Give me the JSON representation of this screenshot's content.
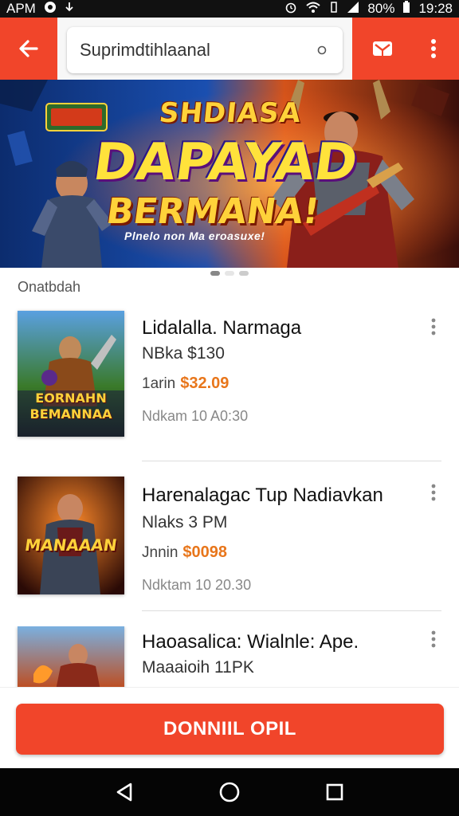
{
  "status_bar": {
    "carrier": "APM",
    "battery_percent": "80%",
    "time": "19:28"
  },
  "app_bar": {
    "search_value": "Suprimdtihlaanal",
    "colors": {
      "accent": "#f1452a"
    }
  },
  "banner": {
    "title_small": "SHDIASA",
    "headline_line1": "DAPAYAD",
    "headline_line2": "BERMANA!",
    "tagline": "Plnelo non Ma eroasuxe!",
    "page_count": 3,
    "active_page": 1
  },
  "section_label": "Onatbdah",
  "items": [
    {
      "title": "Lidalalla. Narmaga",
      "sub": "NBka $130",
      "price_label": "1arin",
      "price": "$32.09",
      "meta": "Ndkam 10 A0:30",
      "thumb_caption": "EORNAHN BEMANNAA"
    },
    {
      "title": "Harenalagac Tup Nadiavkan",
      "sub": "Nlaks 3 PM",
      "price_label": "Jnnin",
      "price": "$0098",
      "meta": "Ndktam 10 20.30",
      "thumb_caption": "MANAAAN"
    },
    {
      "title": "Haoasalica: Wialnle: Ape.",
      "sub": "Maaaioih 11PK",
      "price_label": "",
      "price": "",
      "meta": "",
      "thumb_caption": ""
    }
  ],
  "cta": {
    "label": "DONNIIL OPIL"
  }
}
